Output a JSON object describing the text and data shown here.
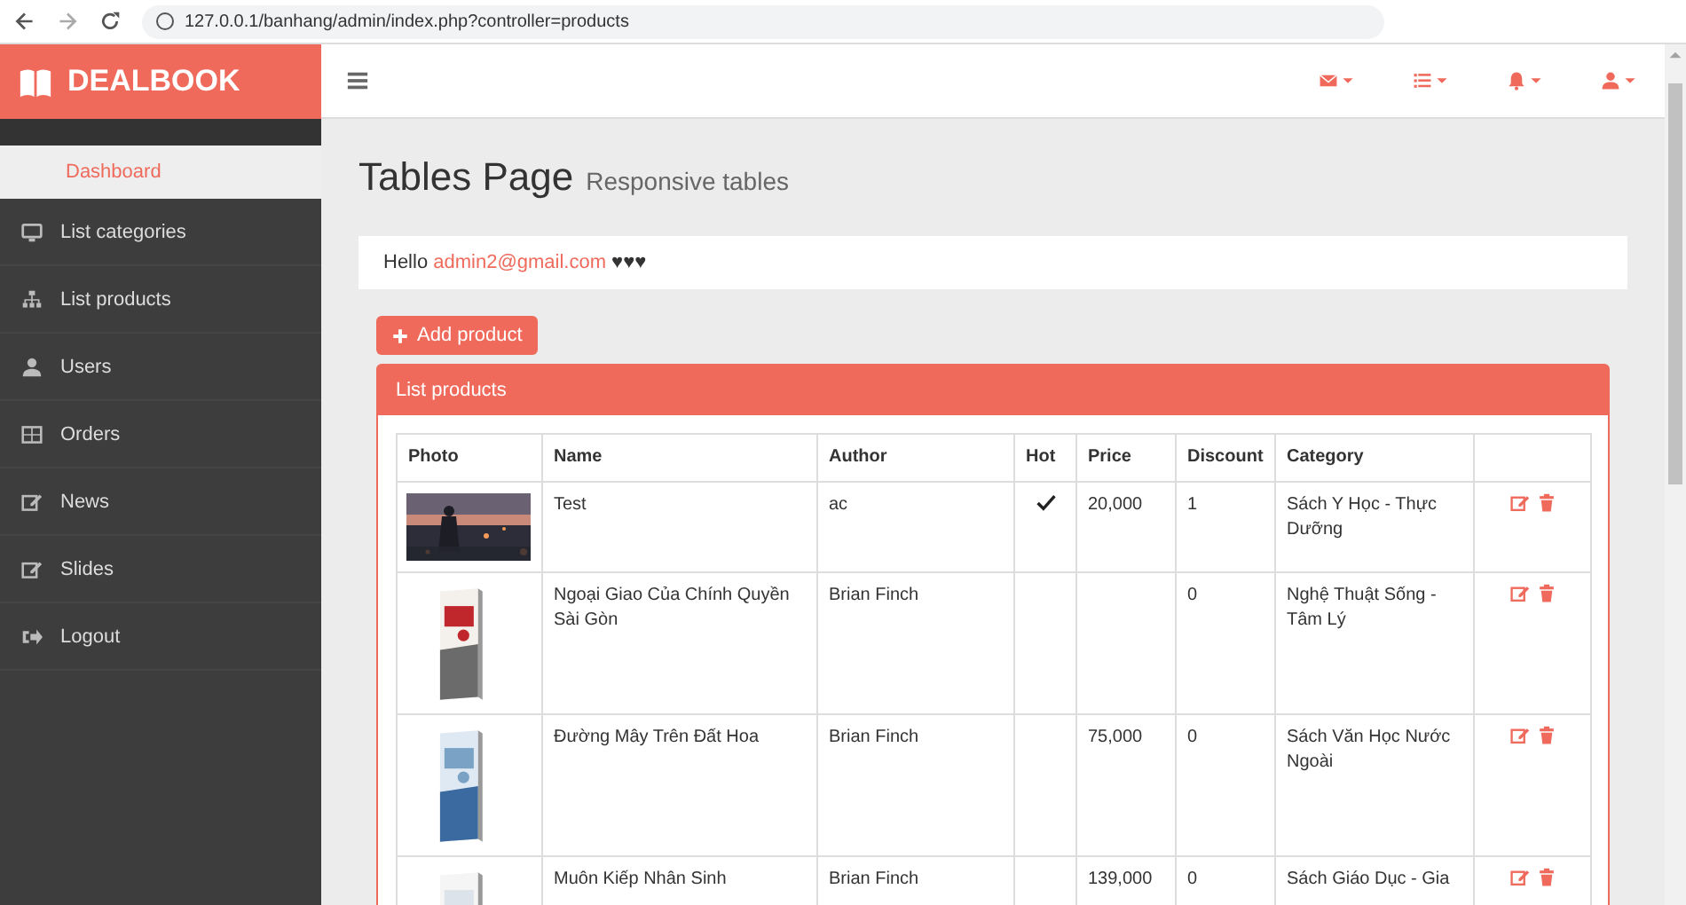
{
  "browser": {
    "url": "127.0.0.1/banhang/admin/index.php?controller=products"
  },
  "brand": "DEALBOOK",
  "sidebar": {
    "items": [
      {
        "label": "Dashboard",
        "kind": "plain",
        "selected": true
      },
      {
        "label": "List categories",
        "kind": "monitor",
        "selected": false
      },
      {
        "label": "List products",
        "kind": "sitemap",
        "selected": false
      },
      {
        "label": "Users",
        "kind": "user",
        "selected": false
      },
      {
        "label": "Orders",
        "kind": "table",
        "selected": false
      },
      {
        "label": "News",
        "kind": "edit",
        "selected": false
      },
      {
        "label": "Slides",
        "kind": "edit",
        "selected": false
      },
      {
        "label": "Logout",
        "kind": "logout",
        "selected": false
      }
    ]
  },
  "page": {
    "title": "Tables Page",
    "subtitle": "Responsive tables"
  },
  "greeting": {
    "text": "Hello",
    "email": "admin2@gmail.com",
    "hearts": "♥♥♥"
  },
  "add_button": "Add product",
  "panel": {
    "title": "List products"
  },
  "table": {
    "columns": [
      "Photo",
      "Name",
      "Author",
      "Hot",
      "Price",
      "Discount",
      "Category"
    ],
    "rows": [
      {
        "name": "Test",
        "author": "ac",
        "hot": true,
        "price": "20,000",
        "discount": "1",
        "category": "Sách Y Học - Thực Dưỡng"
      },
      {
        "name": "Ngoại Giao Của Chính Quyền Sài Gòn",
        "author": "Brian Finch",
        "hot": false,
        "discount": "0",
        "category": "Nghệ Thuật Sống - Tâm Lý"
      },
      {
        "name": "Đường Mây Trên Đất Hoa",
        "author": "Brian Finch",
        "hot": false,
        "price": "75,000",
        "discount": "0",
        "category": "Sách Văn Học Nước Ngoài"
      },
      {
        "name": "Muôn Kiếp Nhân Sinh",
        "author": "Brian Finch",
        "hot": false,
        "price": "139,000",
        "discount": "0",
        "category": "Sách Giáo Dục - Gia"
      }
    ]
  }
}
